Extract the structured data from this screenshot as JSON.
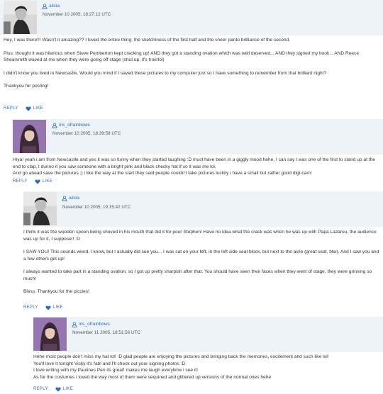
{
  "actions": {
    "reply": "REPLY",
    "like": "LIKE"
  },
  "comments": [
    {
      "user": "ailcia",
      "date": "November 10 2005, 18:27:12 UTC",
      "paragraphs": [
        "Hey, I was there!!! Wasn't it amazing?? I loved the entire thing: the sketchiness of the first half and the sheer panto brilliance of the second.",
        "Plus, thought it was hilarious when Steve Pemberton kept cracking up! AND they got a standing ovation which was well deserved... AND they signed my book... AND Reece Shearsmith waved at me when they were going off stage (shut up, it's true!lol)",
        "I didn't know you lived in Newcastle. Would you mind if I saved these pictures to my computer just so I have something to remember from that brilliant night?",
        "Thankyou for posting!"
      ]
    },
    {
      "user": "iris_ofrainbows",
      "date": "November 10 2005, 18:39:58 UTC",
      "paragraphs": [
        "Hiya! yeah i am from Newcastle and yes it was so funny when they started laughing :D must have been in a giggly mood hehe, I can say I was one of the first to stand up at the end to clap, I dunno if you saw someone with a bright pink and black checky hat if so it was me lol.",
        "And go ahead save the pictures ;) i like the way at the start they said people couldn't take pictures luckily i have a small but rather good digi-cam!"
      ]
    },
    {
      "user": "ailcia",
      "date": "November 10 2005, 19:15:42 UTC",
      "paragraphs": [
        "I think it was the wooden spoon being shoved in his mouth that did it for poor Stephen! Have no idea what the crack was when he was up with Papa Lazarou, the audience was up for it, I suppose!! :D",
        "I SAW YOU! This sounds wierd, I know, but I actually did see you... I was sat on your left, in the left side seat block, but next to the aisle (great seat, btw). And I saw you and a few others get up!",
        "I always wanted to take part in a standing ovation, so I got up pretty sharpish after that. You should have seen their faces when they went of stage, they were grinning so much!",
        "Bless. Thankyou for the piccies!"
      ]
    },
    {
      "user": "iris_ofrainbows",
      "date": "November 11 2005, 18:51:56 UTC",
      "paragraphs": [
        "Hehe most people don't miss my hat lol! :D glad people are enjoying the pictures and bringing back the memories, excitement and such like lol!",
        "You'll love it tonight Vicky it's fab! and I'll check out your signing photos :D",
        "I love writing with my Paulines Pen its great! makes me laugh everytime i see it!",
        "As for the costumes i loved the way most of them were sequined and glittered up versions of the normal ones hehe"
      ]
    }
  ]
}
